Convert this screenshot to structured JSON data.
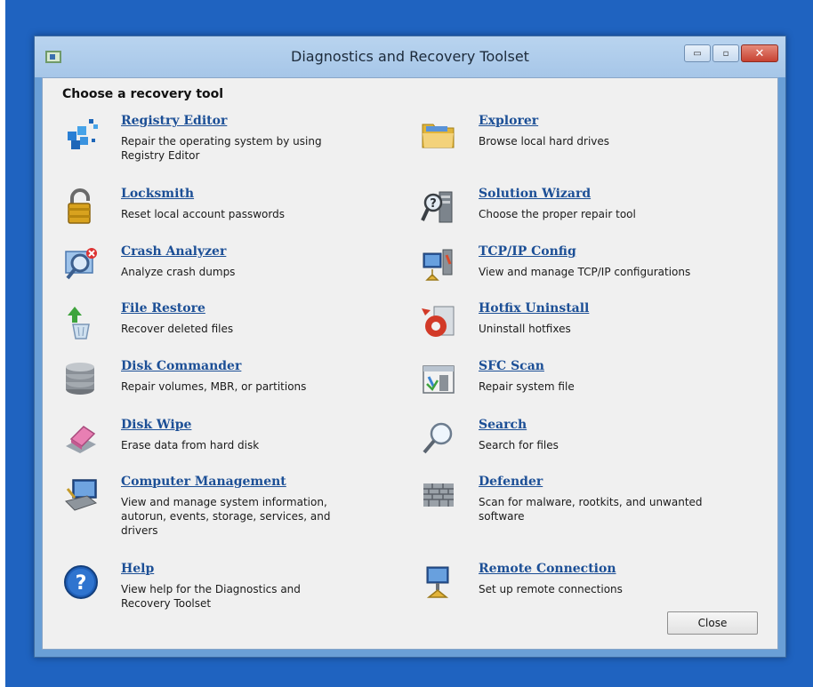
{
  "window": {
    "title": "Diagnostics and Recovery Toolset",
    "heading": "Choose a recovery tool",
    "close_button_label": "Close",
    "min_glyph": "▭",
    "max_glyph": "▫",
    "close_glyph": "✕"
  },
  "tools": {
    "registry_editor": {
      "name": "Registry Editor",
      "desc": "Repair the operating system by using Registry Editor",
      "icon": "registry-icon"
    },
    "locksmith": {
      "name": "Locksmith",
      "desc": "Reset local account passwords",
      "icon": "padlock-icon"
    },
    "crash_analyzer": {
      "name": "Crash Analyzer",
      "desc": "Analyze crash dumps",
      "icon": "crash-magnifier-icon"
    },
    "file_restore": {
      "name": "File Restore",
      "desc": "Recover deleted files",
      "icon": "recycle-restore-icon"
    },
    "disk_commander": {
      "name": "Disk Commander",
      "desc": "Repair volumes, MBR, or partitions",
      "icon": "disk-stack-icon"
    },
    "disk_wipe": {
      "name": "Disk Wipe",
      "desc": "Erase data from hard disk",
      "icon": "eraser-icon"
    },
    "computer_management": {
      "name": "Computer Management",
      "desc": "View and manage system information, autorun, events, storage, services, and drivers",
      "icon": "computer-management-icon"
    },
    "help": {
      "name": "Help",
      "desc": "View help for the Diagnostics and Recovery Toolset",
      "icon": "help-icon"
    },
    "explorer": {
      "name": "Explorer",
      "desc": "Browse local hard drives",
      "icon": "folder-icon"
    },
    "solution_wizard": {
      "name": "Solution Wizard",
      "desc": "Choose the proper repair tool",
      "icon": "wizard-icon"
    },
    "tcpip_config": {
      "name": "TCP/IP Config",
      "desc": "View and manage TCP/IP configurations",
      "icon": "network-config-icon"
    },
    "hotfix_uninstall": {
      "name": "Hotfix Uninstall",
      "desc": "Uninstall hotfixes",
      "icon": "hotfix-icon"
    },
    "sfc_scan": {
      "name": "SFC Scan",
      "desc": "Repair system file",
      "icon": "sfc-icon"
    },
    "search": {
      "name": "Search",
      "desc": "Search for files",
      "icon": "search-icon"
    },
    "defender": {
      "name": "Defender",
      "desc": "Scan for malware, rootkits, and unwanted software",
      "icon": "wall-icon"
    },
    "remote_connection": {
      "name": "Remote Connection",
      "desc": "Set up remote connections",
      "icon": "remote-computer-icon"
    }
  }
}
